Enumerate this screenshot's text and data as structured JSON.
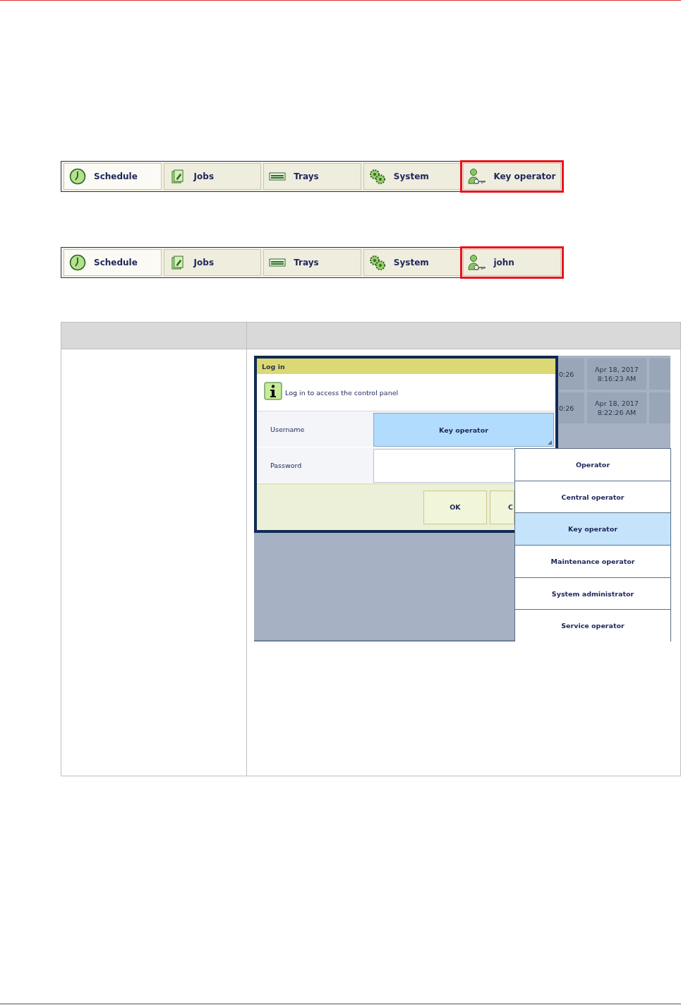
{
  "tab_bars": [
    {
      "tabs": [
        {
          "label": "Schedule",
          "kind": "clock",
          "selected": true,
          "highlighted": false
        },
        {
          "label": "Jobs",
          "kind": "document",
          "selected": false,
          "highlighted": false
        },
        {
          "label": "Trays",
          "kind": "tray",
          "selected": false,
          "highlighted": false
        },
        {
          "label": "System",
          "kind": "gears",
          "selected": false,
          "highlighted": false
        },
        {
          "label": "Key operator",
          "kind": "user",
          "selected": false,
          "highlighted": true
        }
      ]
    },
    {
      "tabs": [
        {
          "label": "Schedule",
          "kind": "clock",
          "selected": true,
          "highlighted": false
        },
        {
          "label": "Jobs",
          "kind": "document",
          "selected": false,
          "highlighted": false
        },
        {
          "label": "Trays",
          "kind": "tray",
          "selected": false,
          "highlighted": false
        },
        {
          "label": "System",
          "kind": "gears",
          "selected": false,
          "highlighted": false
        },
        {
          "label": "john",
          "kind": "user",
          "selected": false,
          "highlighted": true
        }
      ]
    }
  ],
  "login_screenshot": {
    "background_rows": [
      {
        "cells": [
          "0:26",
          "Apr 18, 2017\n8:16:23 AM"
        ]
      },
      {
        "cells": [
          "0:26",
          "Apr 18, 2017\n8:22:26 AM"
        ]
      }
    ],
    "dialog": {
      "title": "Log in",
      "message": "Log in to access the control panel",
      "fields": [
        {
          "label": "Username",
          "kind": "dropdown",
          "value": "Key operator"
        },
        {
          "label": "Password",
          "kind": "password"
        }
      ],
      "buttons": [
        "OK",
        "C"
      ]
    },
    "dropdown": {
      "items": [
        {
          "label": "Operator",
          "selected": false
        },
        {
          "label": "Central operator",
          "selected": false
        },
        {
          "label": "Key operator",
          "selected": true
        },
        {
          "label": "Maintenance operator",
          "selected": false
        },
        {
          "label": "System administrator",
          "selected": false
        },
        {
          "label": "Service operator",
          "selected": false
        }
      ]
    }
  }
}
